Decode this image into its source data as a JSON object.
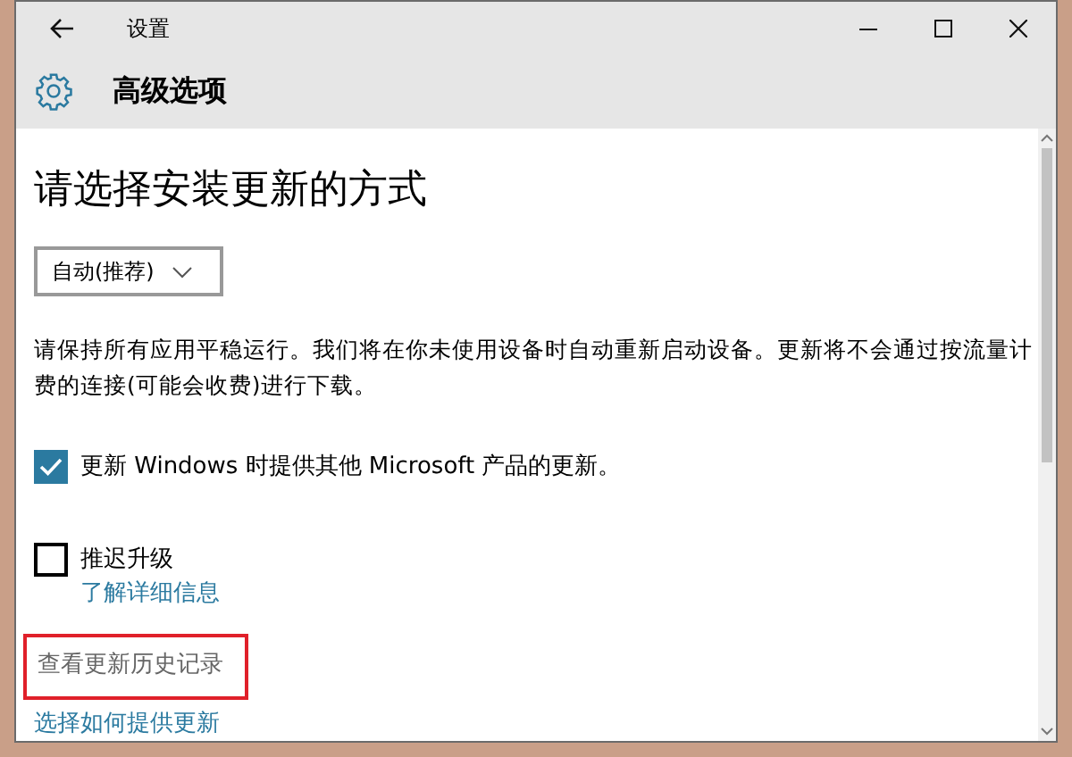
{
  "window": {
    "title": "设置"
  },
  "header": {
    "title": "高级选项"
  },
  "section": {
    "heading": "请选择安装更新的方式",
    "dropdown": {
      "value": "自动(推荐)"
    },
    "description": "请保持所有应用平稳运行。我们将在你未使用设备时自动重新启动设备。更新将不会通过按流量计费的连接(可能会收费)进行下载。"
  },
  "options": [
    {
      "label": "更新 Windows 时提供其他 Microsoft 产品的更新。",
      "checked": true
    },
    {
      "label": "推迟升级",
      "checked": false,
      "link": "了解详细信息"
    }
  ],
  "history_link": {
    "label": "查看更新历史记录",
    "highlighted": true
  },
  "delivery_link": {
    "label": "选择如何提供更新"
  }
}
